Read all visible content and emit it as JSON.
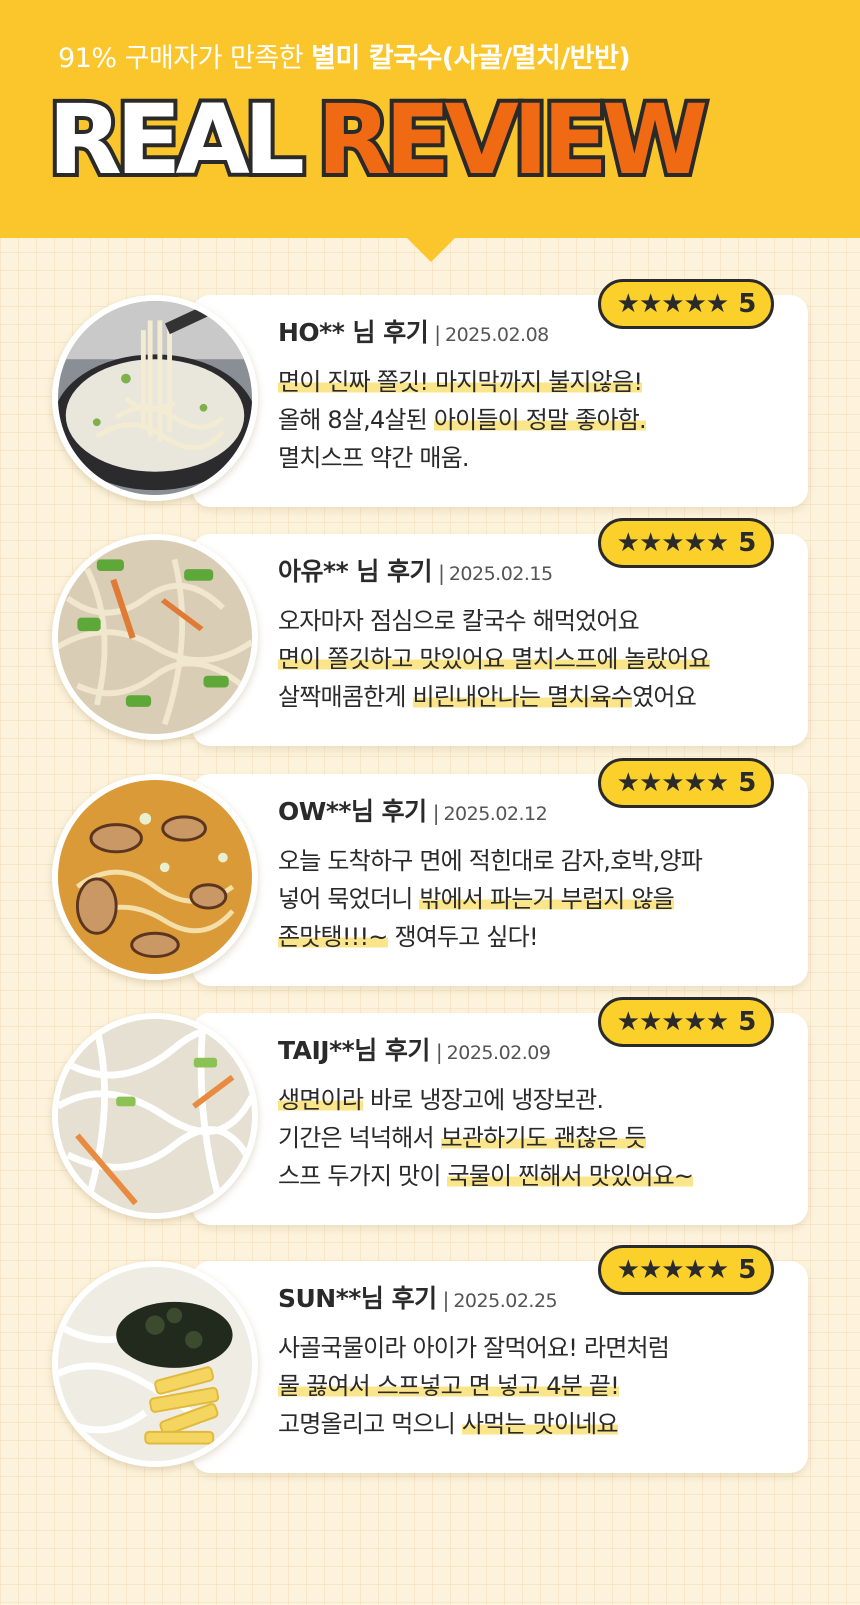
{
  "header": {
    "subtitle_pre": "91% 구매자가 만족한",
    "subtitle_strong": "별미 칼국수(사골/멸치/반반)",
    "title_white": "REAL",
    "title_orange": "REVIEW",
    "colors": {
      "yellow": "#fbc62c",
      "orange": "#f06a13",
      "outline": "#2a2a2a"
    }
  },
  "reviews": [
    {
      "name": "HO** 님 후기",
      "date": "2025.02.08",
      "stars": "★★★★★",
      "rating": "5",
      "photo_icon": "noodle-bowl-photo",
      "lines": [
        [
          {
            "t": "면이 진짜 쫄깃!  마지막까지 불지않음!",
            "h": true
          }
        ],
        [
          {
            "t": "올해 8살,4살된 ",
            "h": false
          },
          {
            "t": "아이들이 정말 좋아함.",
            "h": true
          }
        ],
        [
          {
            "t": "멸치스프 약간 매움.",
            "h": false
          }
        ]
      ]
    },
    {
      "name": "아유** 님 후기",
      "date": "2025.02.15",
      "stars": "★★★★★",
      "rating": "5",
      "photo_icon": "noodle-soup-photo",
      "lines": [
        [
          {
            "t": "오자마자 점심으로 칼국수 해먹었어요",
            "h": false
          }
        ],
        [
          {
            "t": "면이 쫄깃하고 맛있어요 멸치스프에 놀랐어요",
            "h": true
          }
        ],
        [
          {
            "t": "살짝매콤한게 ",
            "h": false
          },
          {
            "t": "비린내안나는 멸치육수",
            "h": true
          },
          {
            "t": "였어요",
            "h": false
          }
        ]
      ]
    },
    {
      "name": "OW**님 후기",
      "date": "2025.02.12",
      "stars": "★★★★★",
      "rating": "5",
      "photo_icon": "mushroom-noodle-photo",
      "lines": [
        [
          {
            "t": "오늘 도착하구 면에 적힌대로 감자,호박,양파",
            "h": false
          }
        ],
        [
          {
            "t": "넣어 묵었더니 ",
            "h": false
          },
          {
            "t": "밖에서 파는거 부럽지 않을",
            "h": true
          }
        ],
        [
          {
            "t": "존맛탱!!!~",
            "h": true
          },
          {
            "t": " 쟁여두고 싶다!",
            "h": false
          }
        ]
      ]
    },
    {
      "name": "TAIJ**님 후기",
      "date": "2025.02.09",
      "stars": "★★★★★",
      "rating": "5",
      "photo_icon": "noodle-closeup-photo",
      "lines": [
        [
          {
            "t": "생면이라",
            "h": true
          },
          {
            "t": " 바로 냉장고에 냉장보관.",
            "h": false
          }
        ],
        [
          {
            "t": "기간은 넉넉해서 ",
            "h": false
          },
          {
            "t": "보관하기도 괜찮은 듯",
            "h": true
          }
        ],
        [
          {
            "t": "스프 두가지 맛이 ",
            "h": false
          },
          {
            "t": "국물이 찐해서 맛있어요~",
            "h": true
          }
        ]
      ]
    },
    {
      "name": "SUN**님 후기",
      "date": "2025.02.25",
      "stars": "★★★★★",
      "rating": "5",
      "photo_icon": "seaweed-egg-noodle-photo",
      "lines": [
        [
          {
            "t": "사골국물이라 아이가 잘먹어요! 라면처럼",
            "h": false
          }
        ],
        [
          {
            "t": "물 끓여서 스프넣고 면 넣고 4분 끝!",
            "h": true
          }
        ],
        [
          {
            "t": "고명올리고 먹으니 ",
            "h": false
          },
          {
            "t": "사먹는 맛이네요",
            "h": true
          }
        ]
      ]
    }
  ]
}
